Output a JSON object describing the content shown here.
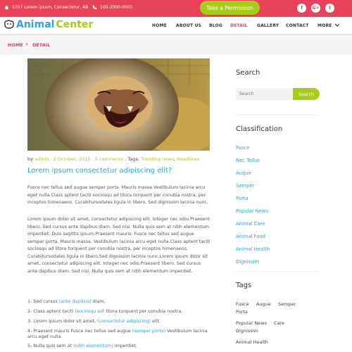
{
  "topbar": {
    "address": "1007 Lorem ipsum, Consectetur, AB",
    "phone": "100-2000-0000",
    "cta_label": "Take a Permission",
    "social": [
      {
        "name": "facebook-icon",
        "glyph": "f"
      },
      {
        "name": "google-plus-icon",
        "glyph": "G+"
      },
      {
        "name": "twitter-icon",
        "glyph": "t"
      }
    ]
  },
  "brand": {
    "word1": "Animal",
    "word2": "Center"
  },
  "nav": {
    "items": [
      "HOME",
      "ABOUT US",
      "BLOG",
      "DETAIL",
      "GALLERY",
      "CONTACT",
      "MORE"
    ],
    "active": "DETAIL"
  },
  "breadcrumb": {
    "home": "HOME",
    "current": "DETAIL"
  },
  "article": {
    "by": "by",
    "author": "admin",
    "date": ". 2 October, 2015 .",
    "comments": "5 comments",
    "tags_prefix": ". Tags:",
    "tag1": "Trending news",
    "tag_sep": ",",
    "tag2": "Headlines",
    "title": "Lorem ipsum consectetur adipiscing elit?",
    "para1": "Fusce nec tellus sed augue semper porta. Mauris massa.Vestibulum lacinia arcu eget nulla.Class aptent taciti sociosqu ad litora torquent per conubia nostra, per inceptos himenaeos. Curabitursodales ligula in libero. Sed dignissim lacinia nunc.",
    "para2": "Lorem ipsum dolor sit amet, consectetur adipiscing elit. Integer nec odio.Praesent libero. Sed cursus ante dapibus diam. Sed nisi. Nulla quis sem at nibh elementum imperdiet. Duis sagittis ipsum.Praesent mauris. Fusce nec tellus sed augue semper porta. Mauris massa. Vestibulum lacinia arcu eget nulla.Class aptent taciti sociosqu ad litora torquent per conubia nostra, per inceptos himenaeos. Curabitursodales ligula in libero.Sed dignissim lacinia nunc.Lorem ipsum dolor sit amet, consectetur adipiscing elit. Integer nec odio.Praesent libero. Sed cursus ante dapibus diam. Sed nisi. Nulla quis sem at nibh elementum imperdiet.",
    "list": [
      {
        "pre": "1- Sed cursus ",
        "hl": "(ante dapibus)",
        "post": " diam."
      },
      {
        "pre": "2- Class aptent taciti ",
        "hl": "(sociosqu ad)",
        "post": " litora torquent per conubia nostra."
      },
      {
        "pre": "3- Lorem ipsum dolor sit amet, ",
        "hl": "(consectetur adipiscing)",
        "post": " elit."
      },
      {
        "pre": "4- Praesent mauris Fusce nec tellus sed augue ",
        "hl": "(semper porta)",
        "post": " Vestibulum lacinia arcu eget nulla."
      },
      {
        "pre": "5- Nulla quis sem at ",
        "hl": "(nibh elementum)",
        "post": " imperdiet."
      }
    ]
  },
  "sidebar": {
    "search_title": "Search",
    "search_placeholder": "Search",
    "search_button": "Search",
    "classification_title": "Classification",
    "categories": [
      "Fusce",
      "Nec Tellus",
      "Augue",
      "Semper",
      "Porta",
      "Popular News",
      "Animal Care",
      "Animal Food",
      "Animal Health",
      "Dignissim"
    ],
    "tags_title": "Tags",
    "tags": [
      "Fusce",
      "Augue",
      "Semper",
      "Porta",
      "Popular News",
      "Care",
      "Dignissim",
      "Animal Health"
    ]
  },
  "colors": {
    "accent_red": "#e8415a",
    "accent_green": "#a6cd18",
    "accent_blue": "#29a7df"
  }
}
